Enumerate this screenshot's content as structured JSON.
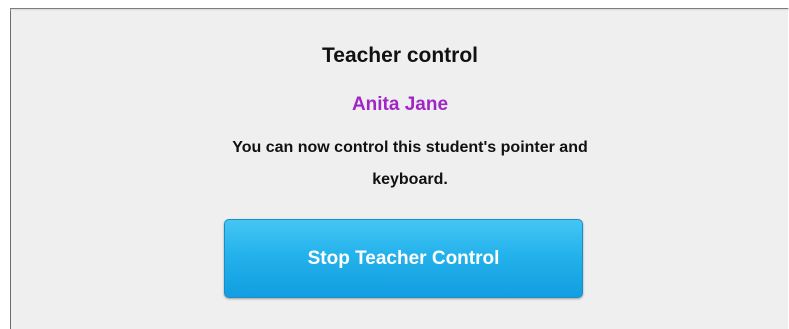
{
  "dialog": {
    "title": "Teacher control",
    "student_name": "Anita Jane",
    "message": "You can now control this student's pointer and keyboard.",
    "stop_button_label": "Stop Teacher Control"
  },
  "colors": {
    "background": "#efefef",
    "student_name": "#a026c6",
    "button": "#24b2ec",
    "button_text": "#ffffff"
  }
}
